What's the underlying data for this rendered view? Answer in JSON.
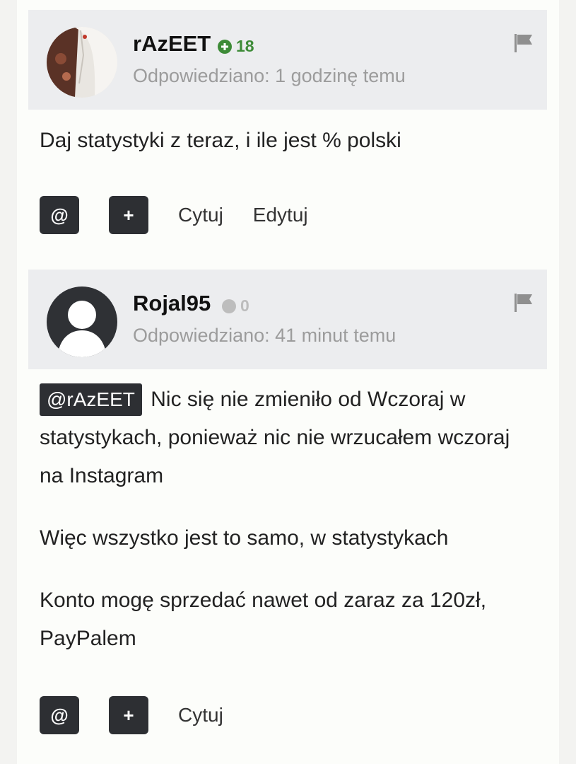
{
  "posts": [
    {
      "username": "rAzEET",
      "reputation": "18",
      "reputation_type": "positive",
      "timestamp": "Odpowiedziano: 1 godzinę temu",
      "body": [
        "Daj statystyki z teraz, i ile jest % polski"
      ],
      "actions": {
        "mention_icon": "@",
        "plus_icon": "+",
        "quote": "Cytuj",
        "edit": "Edytuj"
      }
    },
    {
      "username": "Rojal95",
      "reputation": "0",
      "reputation_type": "neutral",
      "timestamp": "Odpowiedziano: 41 minut temu",
      "mention": "@rAzEET",
      "body": [
        "Nic się nie zmieniło od Wczoraj w statystykach, ponieważ nic nie wrzucałem wczoraj na Instagram",
        "Więc wszystko jest to samo, w statystykach",
        "Konto mogę sprzedać nawet od zaraz za 120zł, PayPalem"
      ],
      "actions": {
        "mention_icon": "@",
        "plus_icon": "+",
        "quote": "Cytuj"
      }
    }
  ],
  "colors": {
    "header_bg": "#ecedef",
    "dark_button": "#2d2f33",
    "rep_positive": "#3d8b37",
    "rep_neutral": "#bdbdbd"
  }
}
